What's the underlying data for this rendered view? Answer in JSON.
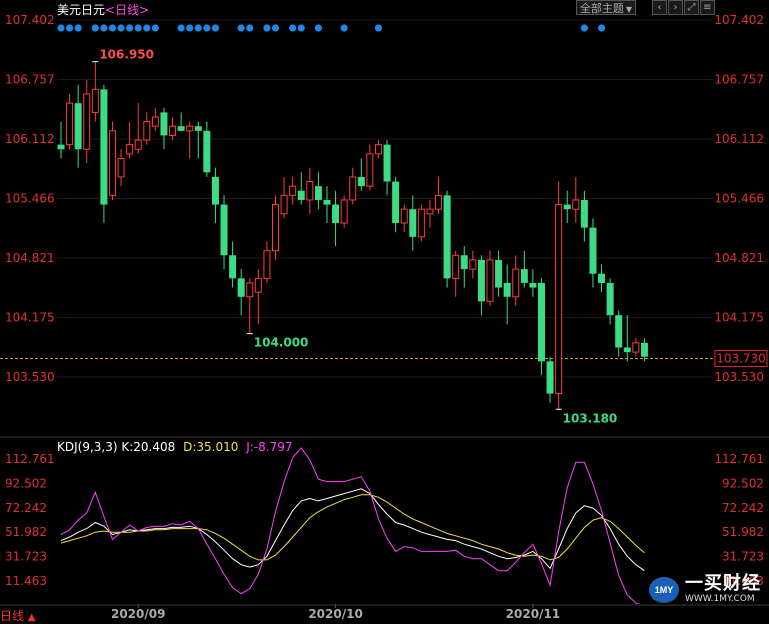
{
  "header": {
    "symbol": "美元日元",
    "period_open": "<",
    "period": "日线",
    "period_close": ">",
    "theme_button": "全部主题",
    "theme_arrow": "▼",
    "nav_prev_icon": "‹",
    "nav_next_icon": "›",
    "fullscreen_icon": "⤢",
    "settings_icon": "≡",
    "colors": {
      "symbol": "#ffffff",
      "period": "#ff4de0"
    }
  },
  "price_axis": {
    "ticks": [
      "107.402",
      "106.757",
      "106.112",
      "105.466",
      "104.821",
      "104.175",
      "103.530"
    ],
    "current_value": "103.730"
  },
  "annotations": {
    "high_label": "106.950",
    "low1_label": "104.000",
    "low2_label": "103.180"
  },
  "kdj": {
    "label": "KDJ(9,3,3)",
    "k_label": "K:20.408",
    "d_label": "D:35.010",
    "j_label": "J:-8.797",
    "ticks": [
      "112.761",
      "92.502",
      "72.242",
      "51.982",
      "31.723",
      "11.463"
    ],
    "colors": {
      "k": "#ffffff",
      "d": "#f0e040",
      "j": "#ff40ff"
    }
  },
  "x_axis": {
    "labels": [
      "2020/09",
      "2020/10",
      "2020/11"
    ]
  },
  "footer": {
    "period_tab": "日线",
    "period_tab_arrow": "▲"
  },
  "watermark": {
    "logo_text": "1MY",
    "brand": "一买财经",
    "url": "WWW.1MY.COM"
  },
  "chart_data": [
    {
      "type": "candlestick",
      "title": "美元日元",
      "period": "日线",
      "ylim": [
        103.0,
        107.5
      ],
      "up_color": "#ff3b3b",
      "down_color": "#3ddc84",
      "current_price": 103.73,
      "annotated_high": 106.95,
      "annotated_lows": [
        104.0,
        103.18
      ],
      "event_dots_at_index": [
        0,
        1,
        2,
        4,
        5,
        6,
        7,
        8,
        9,
        10,
        11,
        14,
        15,
        16,
        17,
        18,
        21,
        22,
        24,
        25,
        27,
        28,
        30,
        33,
        37,
        61,
        63
      ],
      "ohlc": [
        [
          106.05,
          106.3,
          105.9,
          106.0
        ],
        [
          106.05,
          106.6,
          106.0,
          106.5
        ],
        [
          106.5,
          106.7,
          105.8,
          106.0
        ],
        [
          106.0,
          106.75,
          105.85,
          106.6
        ],
        [
          106.4,
          106.95,
          106.3,
          106.65
        ],
        [
          106.65,
          106.7,
          105.2,
          105.4
        ],
        [
          105.5,
          106.3,
          105.45,
          106.2
        ],
        [
          105.7,
          106.0,
          105.6,
          105.9
        ],
        [
          105.95,
          106.3,
          105.9,
          106.05
        ],
        [
          106.0,
          106.5,
          105.95,
          106.1
        ],
        [
          106.1,
          106.4,
          106.05,
          106.3
        ],
        [
          106.25,
          106.45,
          106.2,
          106.35
        ],
        [
          106.4,
          106.45,
          106.0,
          106.15
        ],
        [
          106.15,
          106.35,
          106.1,
          106.25
        ],
        [
          106.25,
          106.4,
          106.2,
          106.2
        ],
        [
          106.2,
          106.3,
          105.9,
          106.25
        ],
        [
          106.25,
          106.3,
          105.9,
          106.2
        ],
        [
          106.2,
          106.3,
          105.7,
          105.75
        ],
        [
          105.7,
          105.8,
          105.2,
          105.4
        ],
        [
          105.4,
          105.5,
          104.7,
          104.85
        ],
        [
          104.85,
          105.0,
          104.5,
          104.6
        ],
        [
          104.6,
          104.7,
          104.2,
          104.4
        ],
        [
          104.4,
          104.6,
          104.0,
          104.55
        ],
        [
          104.45,
          104.7,
          104.1,
          104.6
        ],
        [
          104.6,
          105.0,
          104.55,
          104.9
        ],
        [
          104.9,
          105.5,
          104.8,
          105.4
        ],
        [
          105.3,
          105.7,
          105.25,
          105.5
        ],
        [
          105.5,
          105.7,
          105.4,
          105.6
        ],
        [
          105.55,
          105.75,
          105.4,
          105.45
        ],
        [
          105.45,
          105.8,
          105.3,
          105.65
        ],
        [
          105.6,
          105.75,
          105.35,
          105.45
        ],
        [
          105.45,
          105.6,
          105.2,
          105.4
        ],
        [
          105.4,
          105.55,
          104.95,
          105.2
        ],
        [
          105.2,
          105.5,
          105.15,
          105.45
        ],
        [
          105.45,
          105.8,
          105.4,
          105.7
        ],
        [
          105.7,
          105.9,
          105.55,
          105.6
        ],
        [
          105.6,
          106.05,
          105.55,
          105.95
        ],
        [
          105.95,
          106.1,
          105.9,
          106.05
        ],
        [
          106.05,
          106.1,
          105.5,
          105.65
        ],
        [
          105.65,
          105.7,
          105.1,
          105.2
        ],
        [
          105.2,
          105.4,
          105.1,
          105.35
        ],
        [
          105.35,
          105.5,
          104.9,
          105.05
        ],
        [
          105.05,
          105.4,
          105.0,
          105.35
        ],
        [
          105.3,
          105.45,
          105.15,
          105.35
        ],
        [
          105.35,
          105.7,
          105.3,
          105.5
        ],
        [
          105.5,
          105.55,
          104.5,
          104.6
        ],
        [
          104.6,
          104.9,
          104.4,
          104.85
        ],
        [
          104.85,
          104.95,
          104.5,
          104.7
        ],
        [
          104.7,
          104.9,
          104.6,
          104.8
        ],
        [
          104.8,
          104.85,
          104.2,
          104.35
        ],
        [
          104.35,
          104.9,
          104.3,
          104.8
        ],
        [
          104.8,
          104.9,
          104.4,
          104.5
        ],
        [
          104.55,
          104.75,
          104.1,
          104.4
        ],
        [
          104.4,
          104.85,
          104.3,
          104.7
        ],
        [
          104.7,
          104.9,
          104.5,
          104.55
        ],
        [
          104.55,
          104.7,
          104.4,
          104.5
        ],
        [
          104.55,
          104.6,
          103.55,
          103.7
        ],
        [
          103.7,
          103.75,
          103.25,
          103.35
        ],
        [
          103.35,
          105.65,
          103.18,
          105.4
        ],
        [
          105.4,
          105.55,
          105.2,
          105.35
        ],
        [
          105.35,
          105.7,
          105.2,
          105.45
        ],
        [
          105.45,
          105.55,
          105.0,
          105.15
        ],
        [
          105.15,
          105.25,
          104.5,
          104.65
        ],
        [
          104.65,
          104.75,
          104.45,
          104.55
        ],
        [
          104.55,
          104.6,
          104.1,
          104.2
        ],
        [
          104.2,
          104.25,
          103.75,
          103.85
        ],
        [
          103.85,
          104.2,
          103.7,
          103.8
        ],
        [
          103.8,
          103.95,
          103.75,
          103.9
        ],
        [
          103.9,
          103.95,
          103.7,
          103.75
        ]
      ]
    },
    {
      "type": "line",
      "title": "KDJ(9,3,3)",
      "ylim": [
        0,
        120
      ],
      "series": [
        {
          "name": "K",
          "color": "#ffffff",
          "values": [
            45,
            48,
            52,
            55,
            60,
            57,
            50,
            52,
            54,
            53,
            54,
            55,
            55,
            56,
            56,
            57,
            55,
            50,
            44,
            37,
            30,
            25,
            23,
            25,
            32,
            45,
            58,
            70,
            78,
            80,
            78,
            80,
            82,
            84,
            86,
            88,
            84,
            75,
            67,
            60,
            58,
            55,
            52,
            50,
            48,
            46,
            45,
            42,
            40,
            38,
            35,
            32,
            30,
            31,
            33,
            36,
            30,
            22,
            38,
            55,
            68,
            74,
            72,
            66,
            55,
            42,
            32,
            25,
            20
          ]
        },
        {
          "name": "D",
          "color": "#f0e040",
          "values": [
            43,
            45,
            47,
            49,
            52,
            53,
            52,
            52,
            52,
            53,
            53,
            54,
            54,
            55,
            55,
            55,
            55,
            54,
            51,
            47,
            42,
            37,
            32,
            29,
            29,
            33,
            40,
            48,
            56,
            64,
            69,
            73,
            76,
            79,
            81,
            83,
            83,
            81,
            77,
            72,
            67,
            63,
            60,
            57,
            54,
            51,
            49,
            47,
            45,
            42,
            40,
            38,
            35,
            33,
            32,
            33,
            32,
            29,
            31,
            38,
            47,
            56,
            62,
            64,
            61,
            55,
            48,
            41,
            35
          ]
        },
        {
          "name": "J",
          "color": "#ff40ff",
          "values": [
            50,
            54,
            62,
            68,
            85,
            65,
            46,
            52,
            58,
            53,
            56,
            57,
            57,
            59,
            58,
            61,
            55,
            42,
            30,
            17,
            6,
            1,
            5,
            17,
            38,
            69,
            94,
            114,
            122,
            112,
            96,
            94,
            94,
            94,
            96,
            98,
            86,
            63,
            47,
            36,
            40,
            39,
            36,
            36,
            36,
            36,
            37,
            32,
            30,
            30,
            25,
            20,
            20,
            27,
            35,
            42,
            26,
            8,
            52,
            89,
            110,
            110,
            92,
            70,
            43,
            16,
            0,
            -7,
            -9
          ]
        }
      ]
    }
  ]
}
